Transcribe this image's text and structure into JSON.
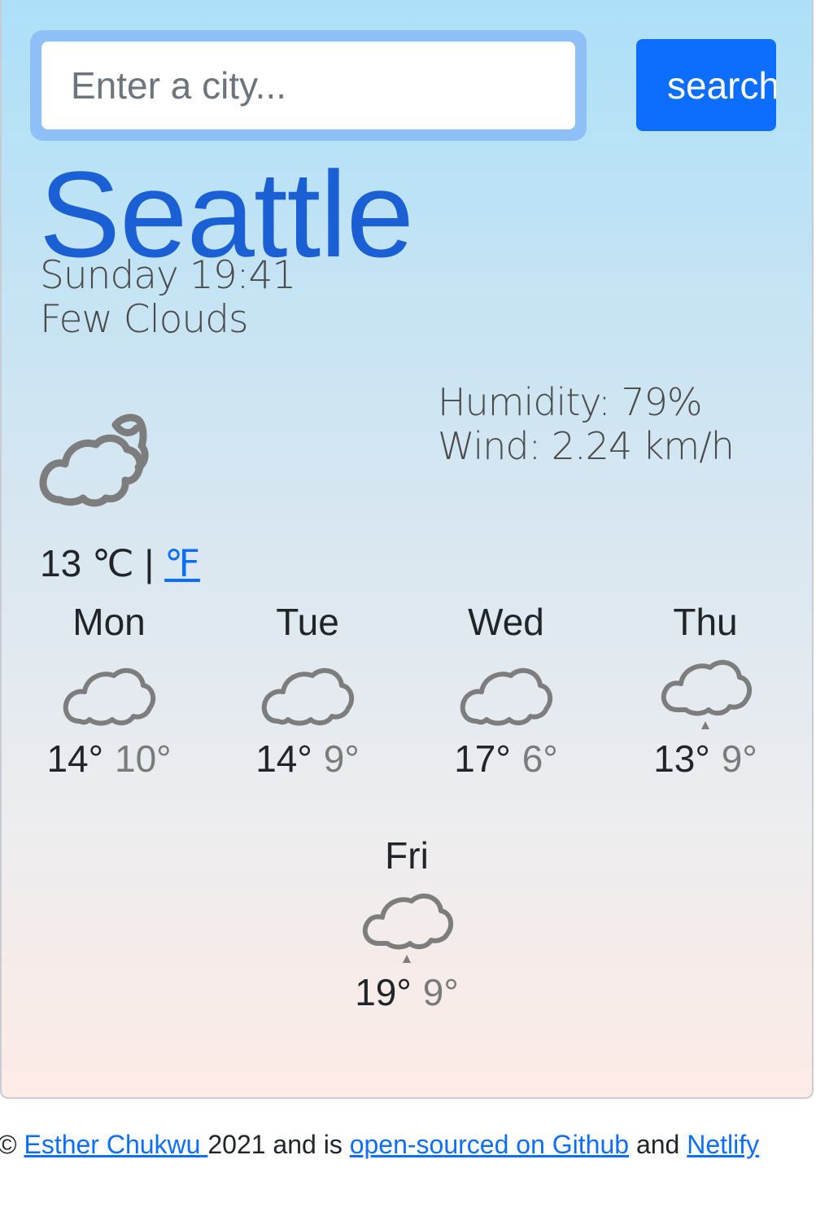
{
  "search": {
    "placeholder": "Enter a city...",
    "button_label": "search"
  },
  "current": {
    "city": "Seattle",
    "datetime": "Sunday 19:41",
    "description": "Few Clouds",
    "humidity": "Humidity: 79%",
    "wind": "Wind: 2.24 km/h",
    "temperature": "13",
    "unit_c": "℃",
    "separator": "|",
    "unit_f": "℉",
    "icon": "few-clouds-night-icon"
  },
  "forecast": [
    {
      "day": "Mon",
      "max": "14°",
      "min": "10°",
      "icon": "cloud-icon"
    },
    {
      "day": "Tue",
      "max": "14°",
      "min": "9°",
      "icon": "cloud-icon"
    },
    {
      "day": "Wed",
      "max": "17°",
      "min": "6°",
      "icon": "cloud-icon"
    },
    {
      "day": "Thu",
      "max": "13°",
      "min": "9°",
      "icon": "rain-cloud-icon"
    },
    {
      "day": "Fri",
      "max": "19°",
      "min": "9°",
      "icon": "rain-cloud-icon"
    }
  ],
  "footer": {
    "copyright": "©",
    "author_link": "Esther Chukwu ",
    "year_text": "2021 and is ",
    "github_link": "open-sourced on Github",
    "and_text": " and ",
    "netlify_link": "Netlify"
  },
  "colors": {
    "accent": "#0d6efd",
    "city": "#1a5fd4",
    "icon_gray": "#7d7d7d"
  }
}
